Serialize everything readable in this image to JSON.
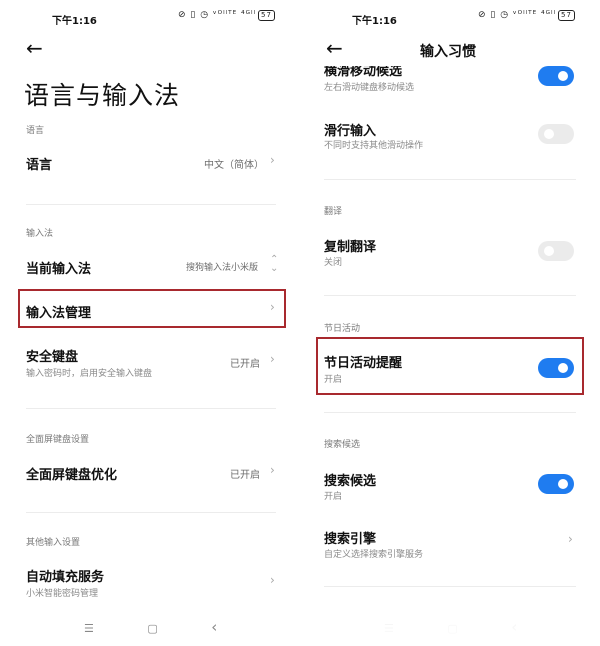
{
  "colors": {
    "accent": "#1f7cf0",
    "highlight": "#a8292e"
  },
  "left": {
    "status": {
      "time": "下午1:16",
      "icons": "⊘ ▯ ◷ ᵛᴼˡˡᵀᴱ ⁴ᴳˡˡ",
      "battery": "57"
    },
    "title": "语言与输入法",
    "sections": {
      "language": {
        "label": "语言",
        "item_title": "语言",
        "item_value": "中文（简体）"
      },
      "input": {
        "label": "输入法",
        "current_title": "当前输入法",
        "current_value": "搜狗输入法小米版",
        "manage_title": "输入法管理",
        "secure_title": "安全键盘",
        "secure_sub": "输入密码时，启用安全输入键盘",
        "secure_value": "已开启"
      },
      "fullscreen": {
        "label": "全面屏键盘设置",
        "item_title": "全面屏键盘优化",
        "item_value": "已开启"
      },
      "other": {
        "label": "其他输入设置",
        "item_title": "自动填充服务",
        "item_sub": "小米智能密码管理"
      }
    }
  },
  "right": {
    "status": {
      "time": "下午1:16",
      "icons": "⊘ ▯ ◷ ᵛᴼˡˡᵀᴱ ⁴ᴳˡˡ",
      "battery": "57"
    },
    "header_title": "输入习惯",
    "items": {
      "swipe_move": {
        "title": "横滑移动候选",
        "sub": "左右滑动键盘移动候选",
        "enabled": true
      },
      "glide": {
        "title": "滑行输入",
        "sub": "不同时支持其他滑动操作",
        "enabled": false
      },
      "translate_label": "翻译",
      "copy_translate": {
        "title": "复制翻译",
        "sub": "关闭",
        "enabled": false
      },
      "holiday_label": "节日活动",
      "holiday_reminder": {
        "title": "节日活动提醒",
        "sub": "开启",
        "enabled": true
      },
      "search_label": "搜索候选",
      "search_candidates": {
        "title": "搜索候选",
        "sub": "开启",
        "enabled": true
      },
      "search_engine": {
        "title": "搜索引擎",
        "sub": "自定义选择搜索引擎服务"
      }
    }
  },
  "navbar": {
    "menu_icon": "☰",
    "home_icon": "▢",
    "back_icon": "‹"
  }
}
